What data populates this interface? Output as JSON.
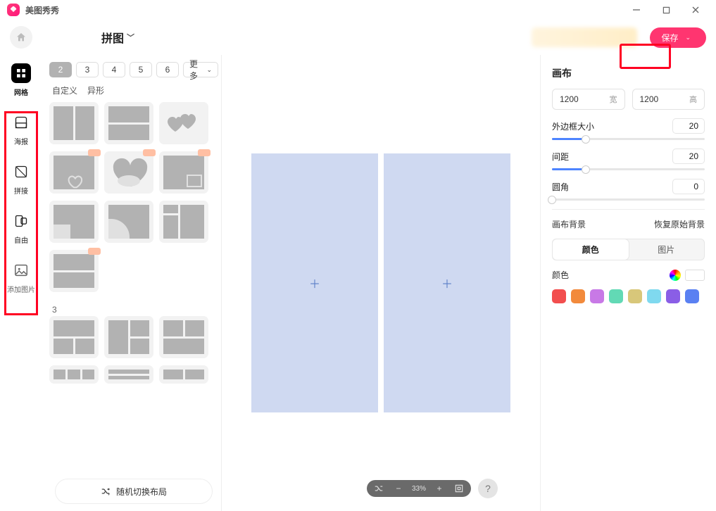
{
  "app": {
    "title": "美图秀秀"
  },
  "header": {
    "collage_label": "拼图",
    "save_label": "保存"
  },
  "toolrail": {
    "grid": "网格",
    "poster": "海报",
    "splice": "拼接",
    "free": "自由",
    "add_image": "添加图片"
  },
  "templates": {
    "counts": [
      "2",
      "3",
      "4",
      "5",
      "6"
    ],
    "more_label": "更多",
    "tab_custom": "自定义",
    "tab_irregular": "异形",
    "section_3": "3",
    "shuffle_label": "随机切换布局"
  },
  "canvas": {
    "zoom": "33%"
  },
  "props": {
    "title": "画布",
    "width_value": "1200",
    "width_label": "宽",
    "height_value": "1200",
    "height_label": "高",
    "border_label": "外边框大小",
    "border_value": "20",
    "gap_label": "间距",
    "gap_value": "20",
    "radius_label": "圆角",
    "radius_value": "0",
    "bg_title": "画布背景",
    "restore_label": "恢复原始背景",
    "seg_color": "颜色",
    "seg_image": "图片",
    "color_label": "颜色",
    "swatches": [
      "#f24e4e",
      "#f28a3c",
      "#c879e6",
      "#62d9b5",
      "#d8c77a",
      "#7fd9ef",
      "#8a5ee6",
      "#5a80f2"
    ]
  }
}
